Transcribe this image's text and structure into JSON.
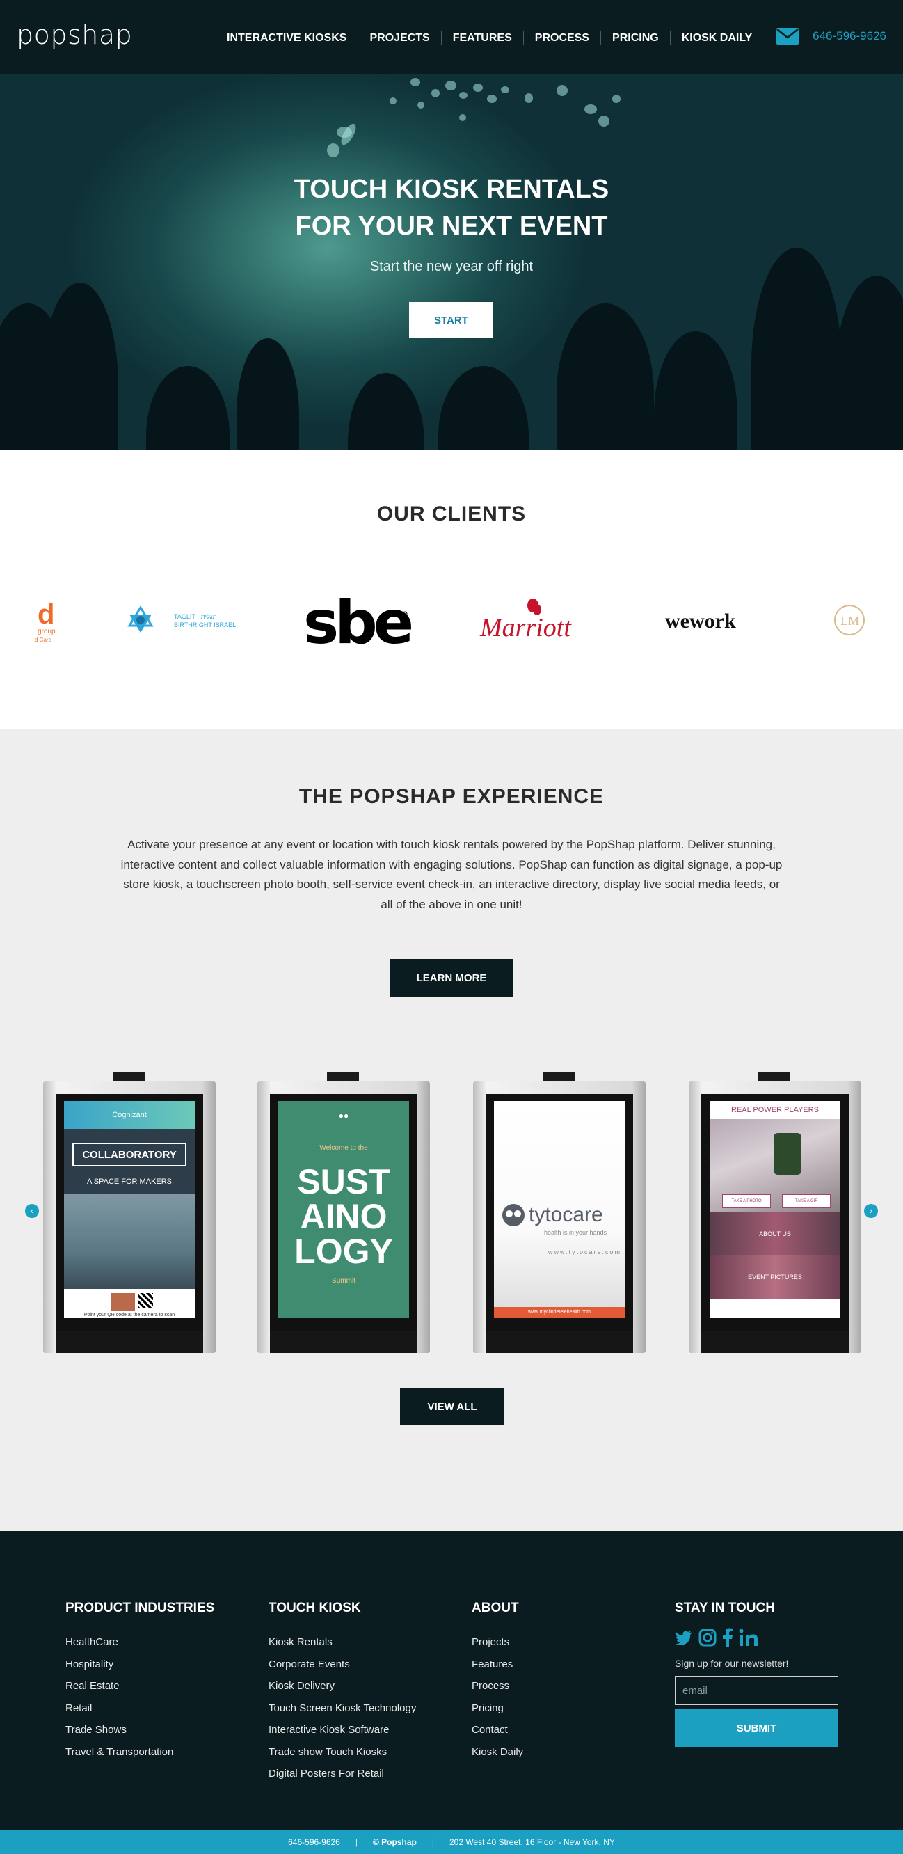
{
  "brand": {
    "logo": "popshap",
    "accent": "#1ca0c1",
    "dark": "#0b1c20"
  },
  "header": {
    "nav": [
      "INTERACTIVE KIOSKS",
      "PROJECTS",
      "FEATURES",
      "PROCESS",
      "PRICING",
      "KIOSK DAILY"
    ],
    "phone": "646-596-9626",
    "mail_icon": "envelope-icon"
  },
  "hero": {
    "title_line1": "TOUCH KIOSK RENTALS",
    "title_line2": "FOR YOUR NEXT EVENT",
    "subtitle": "Start the new year off right",
    "button": "START"
  },
  "clients": {
    "title": "OUR CLIENTS",
    "logos": [
      "d group",
      "TAGLIT BIRTHRIGHT ISRAEL",
      "sbe",
      "Marriott",
      "wework",
      "LM"
    ]
  },
  "experience": {
    "title": "THE POPSHAP EXPERIENCE",
    "text": "Activate your presence at any event or location with touch kiosk rentals powered by the PopShap platform. Deliver stunning, interactive content and collect valuable information with engaging solutions. PopShap can function as digital signage, a pop-up store kiosk, a touchscreen photo booth, self-service event check-in, an interactive directory, display live social media feeds, or all of the above in one unit!",
    "learn_more": "LEARN MORE",
    "view_all": "VIEW ALL",
    "kiosks": [
      {
        "brand": "Cognizant",
        "headline": "COLLABORATORY",
        "sub": "A SPACE FOR MAKERS",
        "foot": "Point your QR code at the camera to scan"
      },
      {
        "welcome": "Welcome to the",
        "headline": "SUST AINO LOGY",
        "sub": "Summit"
      },
      {
        "brand": "tytocare",
        "tagline": "health is in your hands",
        "url": "www.tytocare.com",
        "foot": "www.myclindetelehealth.com"
      },
      {
        "title": "REAL POWER PLAYERS",
        "btn1": "TAKE A PHOTO",
        "btn2": "TAKE A GIF",
        "about": "ABOUT US",
        "pictures": "EVENT PICTURES"
      }
    ]
  },
  "footer": {
    "col1": {
      "title": "PRODUCT INDUSTRIES",
      "links": [
        "HealthCare",
        "Hospitality",
        "Real Estate",
        "Retail",
        "Trade Shows",
        "Travel & Transportation"
      ]
    },
    "col2": {
      "title": "TOUCH KIOSK",
      "links": [
        "Kiosk Rentals",
        "Corporate Events",
        "Kiosk Delivery",
        "Touch Screen Kiosk Technology",
        "Interactive Kiosk Software",
        "Trade show Touch Kiosks",
        "Digital Posters For Retail"
      ]
    },
    "col3": {
      "title": "ABOUT",
      "links": [
        "Projects",
        "Features",
        "Process",
        "Pricing",
        "Contact",
        "Kiosk Daily"
      ]
    },
    "col4": {
      "title": "STAY IN TOUCH",
      "newsletter": "Sign up for our newsletter!",
      "email_placeholder": "email",
      "submit": "SUBMIT"
    }
  },
  "bottom_bar": {
    "phone": "646-596-9626",
    "copyright": "© Popshap",
    "address": "202 West 40 Street, 16 Floor - New York, NY"
  }
}
